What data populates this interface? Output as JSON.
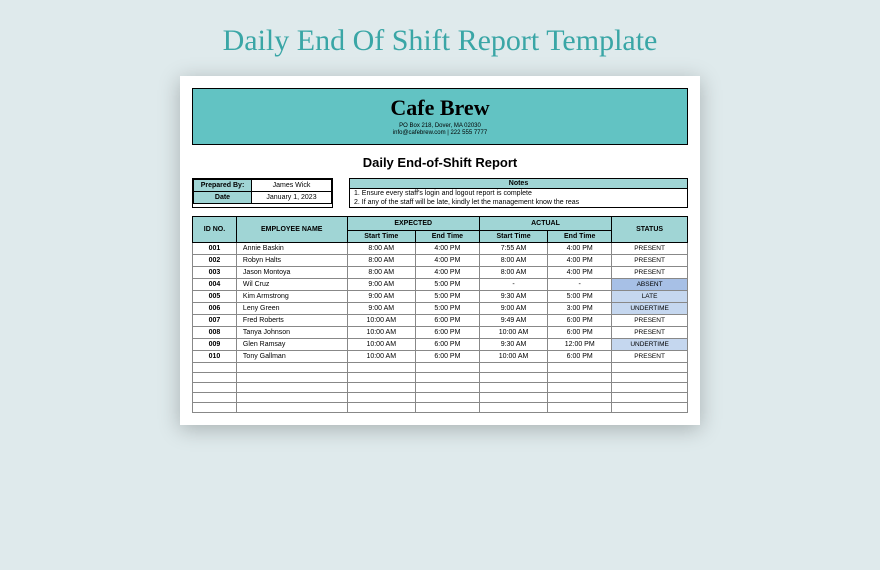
{
  "page_title": "Daily End Of Shift Report Template",
  "banner": {
    "brand": "Cafe Brew",
    "address": "PO Box 218, Dover, MA 02030",
    "contact": "info@cafebrew.com | 222 555 7777"
  },
  "report_title": "Daily End-of-Shift Report",
  "meta": {
    "prepared_by_label": "Prepared By:",
    "prepared_by_value": "James Wick",
    "date_label": "Date",
    "date_value": "January 1, 2023",
    "notes_label": "Notes",
    "note1": "1. Ensure every staff's login and logout report is complete",
    "note2": "2. If any of the staff will be late, kindly let the management know the reas"
  },
  "headers": {
    "id": "ID NO.",
    "name": "EMPLOYEE NAME",
    "expected": "EXPECTED",
    "actual": "ACTUAL",
    "status": "STATUS",
    "start": "Start Time",
    "end": "End Time"
  },
  "rows": [
    {
      "id": "001",
      "name": "Annie Baskin",
      "exp_start": "8:00 AM",
      "exp_end": "4:00 PM",
      "act_start": "7:55 AM",
      "act_end": "4:00 PM",
      "status": "PRESENT",
      "cls": ""
    },
    {
      "id": "002",
      "name": "Robyn Halts",
      "exp_start": "8:00 AM",
      "exp_end": "4:00 PM",
      "act_start": "8:00 AM",
      "act_end": "4:00 PM",
      "status": "PRESENT",
      "cls": ""
    },
    {
      "id": "003",
      "name": "Jason Montoya",
      "exp_start": "8:00 AM",
      "exp_end": "4:00 PM",
      "act_start": "8:00 AM",
      "act_end": "4:00 PM",
      "status": "PRESENT",
      "cls": ""
    },
    {
      "id": "004",
      "name": "Wil Cruz",
      "exp_start": "9:00 AM",
      "exp_end": "5:00 PM",
      "act_start": "-",
      "act_end": "-",
      "status": "ABSENT",
      "cls": "status-absent"
    },
    {
      "id": "005",
      "name": "Kim Armstrong",
      "exp_start": "9:00 AM",
      "exp_end": "5:00 PM",
      "act_start": "9:30 AM",
      "act_end": "5:00 PM",
      "status": "LATE",
      "cls": "status-late"
    },
    {
      "id": "006",
      "name": "Leny Green",
      "exp_start": "9:00 AM",
      "exp_end": "5:00 PM",
      "act_start": "9:00 AM",
      "act_end": "3:00 PM",
      "status": "UNDERTIME",
      "cls": "status-undertime"
    },
    {
      "id": "007",
      "name": "Fred Roberts",
      "exp_start": "10:00 AM",
      "exp_end": "6:00 PM",
      "act_start": "9:49 AM",
      "act_end": "6:00 PM",
      "status": "PRESENT",
      "cls": ""
    },
    {
      "id": "008",
      "name": "Tanya Johnson",
      "exp_start": "10:00 AM",
      "exp_end": "6:00 PM",
      "act_start": "10:00 AM",
      "act_end": "6:00 PM",
      "status": "PRESENT",
      "cls": ""
    },
    {
      "id": "009",
      "name": "Glen Ramsay",
      "exp_start": "10:00 AM",
      "exp_end": "6:00 PM",
      "act_start": "9:30 AM",
      "act_end": "12:00 PM",
      "status": "UNDERTIME",
      "cls": "status-undertime"
    },
    {
      "id": "010",
      "name": "Tony Gallman",
      "exp_start": "10:00 AM",
      "exp_end": "6:00 PM",
      "act_start": "10:00 AM",
      "act_end": "6:00 PM",
      "status": "PRESENT",
      "cls": ""
    }
  ],
  "blank_rows": 5
}
